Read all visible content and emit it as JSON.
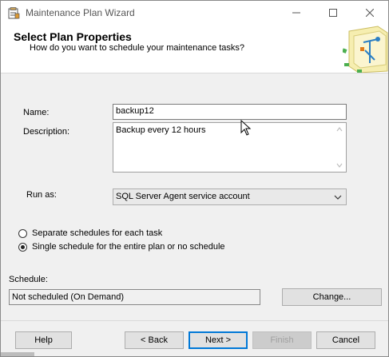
{
  "window": {
    "title": "Maintenance Plan Wizard"
  },
  "header": {
    "title": "Select Plan Properties",
    "subtitle": "How do you want to schedule your maintenance tasks?"
  },
  "form": {
    "name_label": "Name:",
    "name_value": "backup12",
    "description_label": "Description:",
    "description_value": "Backup every 12 hours",
    "run_as_label": "Run as:",
    "run_as_value": "SQL Server Agent service account"
  },
  "schedule_options": {
    "separate_label": "Separate schedules for each task",
    "single_label": "Single schedule for the entire plan or no schedule",
    "selected": "single"
  },
  "schedule": {
    "label": "Schedule:",
    "value": "Not scheduled (On Demand)",
    "change_button": "Change..."
  },
  "footer": {
    "help": "Help",
    "back": "< Back",
    "next": "Next >",
    "finish": "Finish",
    "cancel": "Cancel"
  },
  "icons": {
    "app": "maintenance-plan-icon",
    "minimize": "minimize-icon",
    "maximize": "maximize-icon",
    "close": "close-icon"
  }
}
